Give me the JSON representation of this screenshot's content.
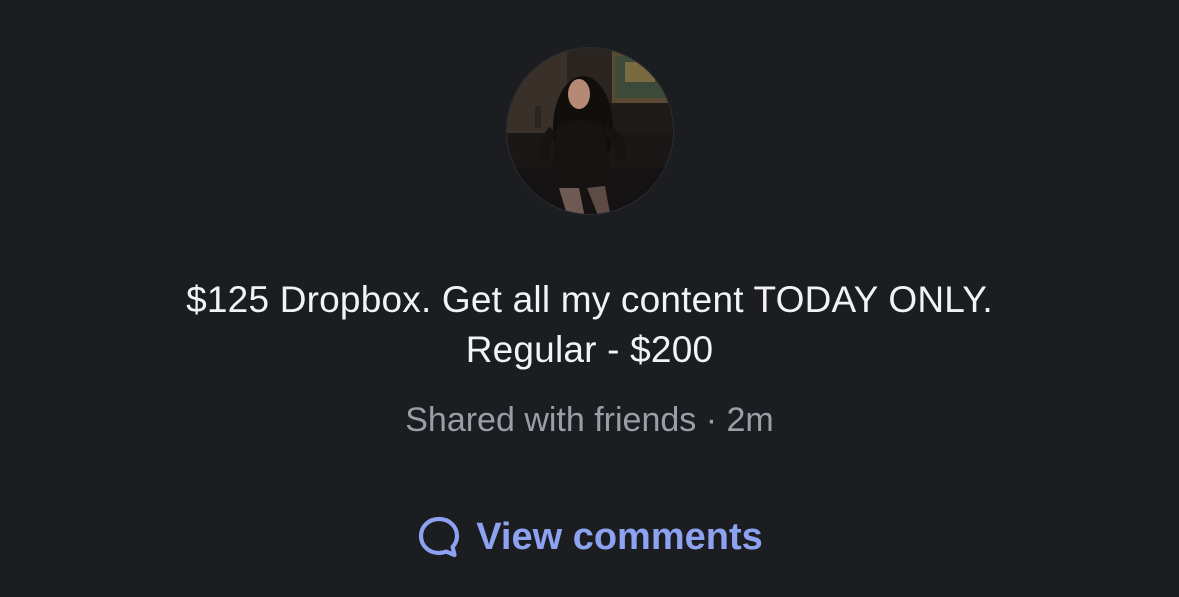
{
  "post": {
    "avatar_icon": "profile-photo",
    "message_line1": "$125 Dropbox. Get all my content TODAY ONLY.",
    "message_line2": "Regular - $200",
    "audience": "Shared with friends",
    "separator": "·",
    "time_ago": "2m"
  },
  "actions": {
    "view_comments_label": "View comments",
    "view_comments_icon": "speech-bubble-icon"
  },
  "colors": {
    "background": "#1b1d21",
    "text_primary": "#f2f3f5",
    "text_secondary": "#9a9ea6",
    "accent": "#8da2f0"
  }
}
